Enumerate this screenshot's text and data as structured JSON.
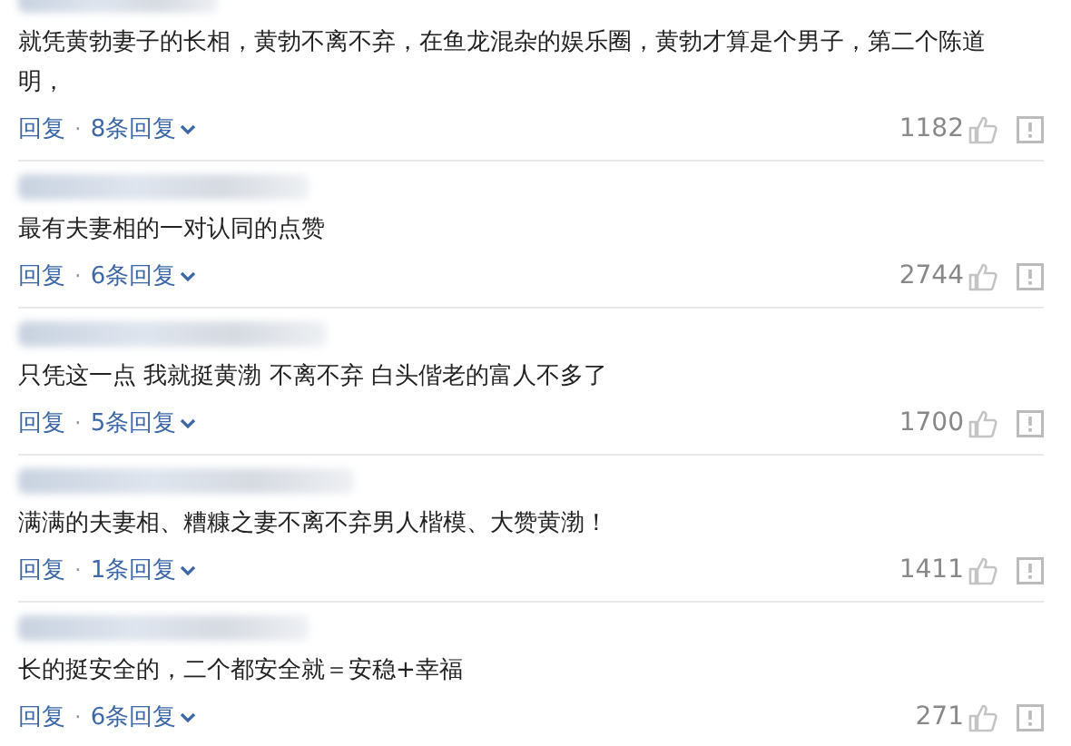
{
  "comments": [
    {
      "text": "就凭黄勃妻子的长相，黄勃不离不弃，在鱼龙混杂的娱乐圈，黄勃才算是个男子，第二个陈道明，",
      "reply": "回复",
      "separator": "·",
      "replies": "8条回复",
      "likes": "1182"
    },
    {
      "text": "最有夫妻相的一对认同的点赞",
      "reply": "回复",
      "separator": "·",
      "replies": "6条回复",
      "likes": "2744"
    },
    {
      "text": "只凭这一点 我就挺黄渤 不离不弃 白头偕老的富人不多了",
      "reply": "回复",
      "separator": "·",
      "replies": "5条回复",
      "likes": "1700"
    },
    {
      "text": "满满的夫妻相、糟糠之妻不离不弃男人楷模、大赞黄渤！",
      "reply": "回复",
      "separator": "·",
      "replies": "1条回复",
      "likes": "1411"
    },
    {
      "text": "长的挺安全的，二个都安全就＝安稳+幸福",
      "reply": "回复",
      "separator": "·",
      "replies": "6条回复",
      "likes": "271"
    }
  ]
}
